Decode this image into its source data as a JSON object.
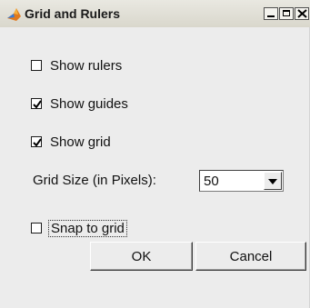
{
  "window": {
    "title": "Grid and Rulers"
  },
  "options": {
    "show_rulers": {
      "label": "Show rulers",
      "checked": false
    },
    "show_guides": {
      "label": "Show guides",
      "checked": true
    },
    "show_grid": {
      "label": "Show grid",
      "checked": true
    },
    "snap_to_grid": {
      "label": "Snap to grid",
      "checked": false
    }
  },
  "grid_size": {
    "label": "Grid Size (in Pixels):",
    "value": "50"
  },
  "buttons": {
    "ok": "OK",
    "cancel": "Cancel"
  },
  "icons": {
    "app": "matlab-logo-icon",
    "minimize": "minimize-icon",
    "maximize": "maximize-icon",
    "close": "close-icon",
    "dropdown": "dropdown-arrow-icon"
  }
}
